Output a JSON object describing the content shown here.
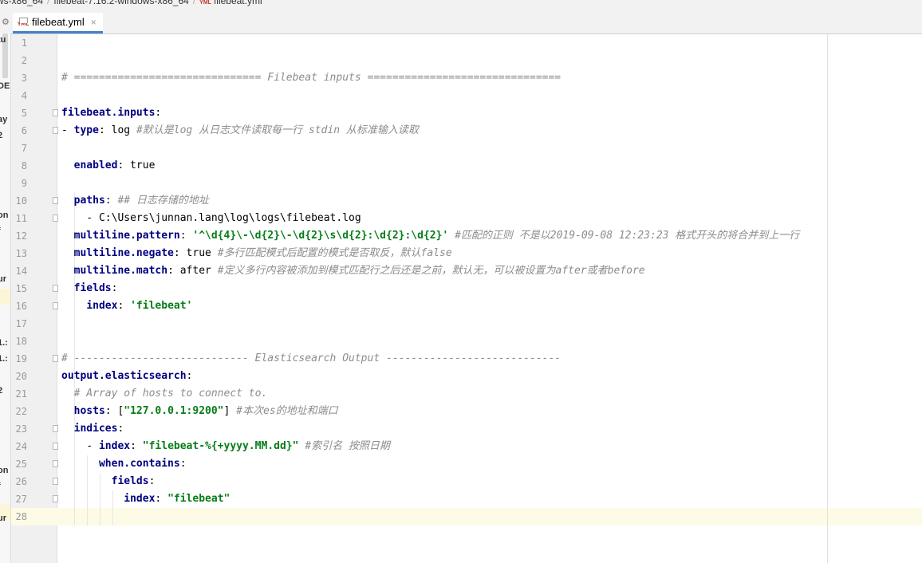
{
  "breadcrumb": {
    "items": [
      "ws-x86_64",
      "filebeat-7.16.2-windows-x86_64",
      "filebeat.yml"
    ],
    "file_badge": "YML"
  },
  "tab": {
    "label": "filebeat.yml",
    "badge": "YML",
    "close_glyph": "×",
    "accent": "#4083c9"
  },
  "sidebar_fragments": [
    "tu",
    "DE",
    "ay",
    "2",
    "on",
    "f",
    "ur",
    "1.:",
    "1.:",
    "2",
    "on",
    "f",
    "ur"
  ],
  "editor": {
    "current_line": 28,
    "colors": {
      "key": "#000080",
      "string": "#067d17",
      "comment": "#8c8c8c"
    },
    "lines": [
      {
        "n": "1",
        "parts": []
      },
      {
        "n": "2",
        "parts": []
      },
      {
        "n": "3",
        "parts": [
          {
            "t": "c",
            "v": "# ============================== Filebeat inputs ==============================="
          }
        ]
      },
      {
        "n": "4",
        "parts": []
      },
      {
        "n": "5",
        "fold": true,
        "parts": [
          {
            "t": "k",
            "v": "filebeat.inputs"
          },
          {
            "t": "p",
            "v": ":"
          }
        ]
      },
      {
        "n": "6",
        "fold": true,
        "parts": [
          {
            "t": "p",
            "v": "- "
          },
          {
            "t": "k",
            "v": "type"
          },
          {
            "t": "p",
            "v": ": log "
          },
          {
            "t": "c",
            "v": "#默认是log 从日志文件读取每一行 stdin 从标准输入读取"
          }
        ]
      },
      {
        "n": "7",
        "parts": []
      },
      {
        "n": "8",
        "parts": [
          {
            "t": "p",
            "v": "  "
          },
          {
            "t": "k",
            "v": "enabled"
          },
          {
            "t": "p",
            "v": ": true"
          }
        ]
      },
      {
        "n": "9",
        "parts": []
      },
      {
        "n": "10",
        "fold": true,
        "parts": [
          {
            "t": "p",
            "v": "  "
          },
          {
            "t": "k",
            "v": "paths"
          },
          {
            "t": "p",
            "v": ": "
          },
          {
            "t": "c",
            "v": "## 日志存储的地址"
          }
        ]
      },
      {
        "n": "11",
        "fold": true,
        "parts": [
          {
            "t": "p",
            "v": "    - C:\\Users\\junnan.lang\\log\\logs\\filebeat.log"
          }
        ]
      },
      {
        "n": "12",
        "parts": [
          {
            "t": "p",
            "v": "  "
          },
          {
            "t": "k",
            "v": "multiline.pattern"
          },
          {
            "t": "p",
            "v": ": "
          },
          {
            "t": "s",
            "v": "'^\\d{4}\\-\\d{2}\\-\\d{2}\\s\\d{2}:\\d{2}:\\d{2}'"
          },
          {
            "t": "p",
            "v": " "
          },
          {
            "t": "c",
            "v": "#匹配的正则 不是以2019-09-08 12:23:23 格式开头的将合并到上一行"
          }
        ]
      },
      {
        "n": "13",
        "parts": [
          {
            "t": "p",
            "v": "  "
          },
          {
            "t": "k",
            "v": "multiline.negate"
          },
          {
            "t": "p",
            "v": ": true "
          },
          {
            "t": "c",
            "v": "#多行匹配模式后配置的模式是否取反，默认false"
          }
        ]
      },
      {
        "n": "14",
        "parts": [
          {
            "t": "p",
            "v": "  "
          },
          {
            "t": "k",
            "v": "multiline.match"
          },
          {
            "t": "p",
            "v": ": after "
          },
          {
            "t": "c",
            "v": "#定义多行内容被添加到模式匹配行之后还是之前，默认无，可以被设置为after或者before"
          }
        ]
      },
      {
        "n": "15",
        "fold": true,
        "parts": [
          {
            "t": "p",
            "v": "  "
          },
          {
            "t": "k",
            "v": "fields"
          },
          {
            "t": "p",
            "v": ":"
          }
        ]
      },
      {
        "n": "16",
        "fold": true,
        "parts": [
          {
            "t": "p",
            "v": "    "
          },
          {
            "t": "k",
            "v": "index"
          },
          {
            "t": "p",
            "v": ": "
          },
          {
            "t": "s",
            "v": "'filebeat'"
          }
        ]
      },
      {
        "n": "17",
        "parts": []
      },
      {
        "n": "18",
        "parts": []
      },
      {
        "n": "19",
        "fold": true,
        "parts": [
          {
            "t": "c",
            "v": "# ---------------------------- Elasticsearch Output ----------------------------"
          }
        ]
      },
      {
        "n": "20",
        "parts": [
          {
            "t": "k",
            "v": "output.elasticsearch"
          },
          {
            "t": "p",
            "v": ":"
          }
        ]
      },
      {
        "n": "21",
        "parts": [
          {
            "t": "p",
            "v": "  "
          },
          {
            "t": "c",
            "v": "# Array of hosts to connect to."
          }
        ]
      },
      {
        "n": "22",
        "parts": [
          {
            "t": "p",
            "v": "  "
          },
          {
            "t": "k",
            "v": "hosts"
          },
          {
            "t": "p",
            "v": ": ["
          },
          {
            "t": "s",
            "v": "\"127.0.0.1:9200\""
          },
          {
            "t": "p",
            "v": "] "
          },
          {
            "t": "c",
            "v": "#本次es的地址和端口"
          }
        ]
      },
      {
        "n": "23",
        "fold": true,
        "parts": [
          {
            "t": "p",
            "v": "  "
          },
          {
            "t": "k",
            "v": "indices"
          },
          {
            "t": "p",
            "v": ":"
          }
        ]
      },
      {
        "n": "24",
        "fold": true,
        "parts": [
          {
            "t": "p",
            "v": "    - "
          },
          {
            "t": "k",
            "v": "index"
          },
          {
            "t": "p",
            "v": ": "
          },
          {
            "t": "s",
            "v": "\"filebeat-%{+yyyy.MM.dd}\""
          },
          {
            "t": "p",
            "v": " "
          },
          {
            "t": "c",
            "v": "#索引名 按照日期"
          }
        ]
      },
      {
        "n": "25",
        "fold": true,
        "parts": [
          {
            "t": "p",
            "v": "      "
          },
          {
            "t": "k",
            "v": "when.contains"
          },
          {
            "t": "p",
            "v": ":"
          }
        ]
      },
      {
        "n": "26",
        "fold": true,
        "parts": [
          {
            "t": "p",
            "v": "        "
          },
          {
            "t": "k",
            "v": "fields"
          },
          {
            "t": "p",
            "v": ":"
          }
        ]
      },
      {
        "n": "27",
        "fold": true,
        "parts": [
          {
            "t": "p",
            "v": "          "
          },
          {
            "t": "k",
            "v": "index"
          },
          {
            "t": "p",
            "v": ": "
          },
          {
            "t": "s",
            "v": "\"filebeat\""
          }
        ]
      },
      {
        "n": "28",
        "parts": []
      }
    ]
  }
}
